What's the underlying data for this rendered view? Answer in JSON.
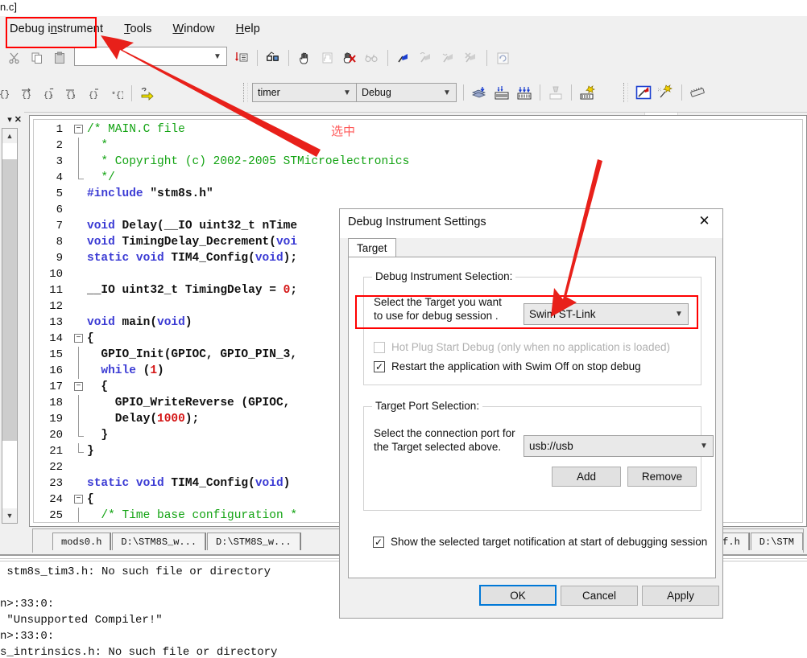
{
  "window": {
    "title_fragment": "n.c]"
  },
  "menubar": {
    "items": [
      {
        "name": "debug-instrument",
        "pre": "Debug i",
        "u": "n",
        "post": "strument"
      },
      {
        "name": "tools",
        "pre": "",
        "u": "T",
        "post": "ools"
      },
      {
        "name": "window",
        "pre": "",
        "u": "W",
        "post": "indow"
      },
      {
        "name": "help",
        "pre": "",
        "u": "H",
        "post": "elp"
      }
    ]
  },
  "toolbar_top": {
    "cut_icon": "scissors-icon",
    "copy_icon": "copy-icon",
    "paste_icon": "paste-icon",
    "find_combo_value": "",
    "find_combo_placeholder": "",
    "goto_icon": "goto-line-icon",
    "binoculars_icon": "find-in-files-icon",
    "hand_icon": "hand-icon",
    "page_icon": "page-icon",
    "no_glasses_icon": "disable-watch-icon",
    "glasses_icon": "watch-icon",
    "flag_blue_icon": "bookmark-flag-icon",
    "flag_next_icon": "next-bookmark-icon",
    "flag_prev_icon": "prev-bookmark-icon",
    "flag_clear_icon": "clear-bookmark-icon",
    "refresh_icon": "refresh-icon",
    "printer_gear_icon": "printer-settings-icon"
  },
  "toolbar_second": {
    "brace_icons": [
      "brace-icon",
      "brace-right-icon",
      "brace-up-icon",
      "brace-down-icon",
      "brace-match-icon",
      "brace-star-icon"
    ],
    "yellow_arrow_icon": "run-to-cursor-icon",
    "project_combo_value": "timer",
    "config_combo_value": "Debug",
    "build_icon": "build-icon",
    "rebuild_icon": "rebuild-all-icon",
    "batch_build_icon": "batch-build-icon",
    "clean_icon": "clean-icon",
    "settings_icon": "project-settings-icon",
    "debug_icon": "start-debug-icon",
    "debug_settings_icon": "debug-settings-icon",
    "chip_icon": "chip-icon"
  },
  "left_dock": {
    "dropdown_icon": "chevron-down-icon",
    "close_icon": "close-icon",
    "scroll_up_icon": "scroll-up-icon",
    "scroll_down_icon": "scroll-down-icon"
  },
  "editor": {
    "annotation_cn": "选中",
    "lines": [
      {
        "n": "1",
        "fold": "minus-top",
        "segs": [
          {
            "t": "/* MAIN.C file",
            "c": "c-com"
          }
        ]
      },
      {
        "n": "2",
        "fold": "line",
        "segs": [
          {
            "t": "  *",
            "c": "c-com"
          }
        ]
      },
      {
        "n": "3",
        "fold": "line",
        "segs": [
          {
            "t": "  * Copyright (c) 2002-2005 STMicroelectronics",
            "c": "c-com"
          }
        ]
      },
      {
        "n": "4",
        "fold": "end",
        "segs": [
          {
            "t": "  */",
            "c": "c-com"
          }
        ]
      },
      {
        "n": "5",
        "fold": "",
        "segs": [
          {
            "t": "#include ",
            "c": "c-pre"
          },
          {
            "t": "\"stm8s.h\"",
            "c": "c-str"
          }
        ]
      },
      {
        "n": "6",
        "fold": "",
        "segs": [
          {
            "t": "",
            "c": "c-pl"
          }
        ]
      },
      {
        "n": "7",
        "fold": "",
        "segs": [
          {
            "t": "void ",
            "c": "c-kw c-bold"
          },
          {
            "t": "Delay(__IO uint32_t nTime",
            "c": "c-pl c-bold"
          }
        ]
      },
      {
        "n": "8",
        "fold": "",
        "segs": [
          {
            "t": "void ",
            "c": "c-kw c-bold"
          },
          {
            "t": "TimingDelay_Decrement(",
            "c": "c-pl c-bold"
          },
          {
            "t": "voi",
            "c": "c-kw c-bold"
          }
        ]
      },
      {
        "n": "9",
        "fold": "",
        "segs": [
          {
            "t": "static void ",
            "c": "c-kw c-bold"
          },
          {
            "t": "TIM4_Config(",
            "c": "c-pl c-bold"
          },
          {
            "t": "void",
            "c": "c-kw c-bold"
          },
          {
            "t": ");",
            "c": "c-pl c-bold"
          }
        ]
      },
      {
        "n": "10",
        "fold": "",
        "segs": [
          {
            "t": "",
            "c": "c-pl"
          }
        ]
      },
      {
        "n": "11",
        "fold": "",
        "segs": [
          {
            "t": "__IO uint32_t TimingDelay = ",
            "c": "c-pl c-bold"
          },
          {
            "t": "0",
            "c": "c-num c-bold"
          },
          {
            "t": ";",
            "c": "c-pl c-bold"
          }
        ]
      },
      {
        "n": "12",
        "fold": "",
        "segs": [
          {
            "t": "",
            "c": "c-pl"
          }
        ]
      },
      {
        "n": "13",
        "fold": "",
        "segs": [
          {
            "t": "void ",
            "c": "c-kw c-bold"
          },
          {
            "t": "main(",
            "c": "c-pl c-bold"
          },
          {
            "t": "void",
            "c": "c-kw c-bold"
          },
          {
            "t": ")",
            "c": "c-pl c-bold"
          }
        ]
      },
      {
        "n": "14",
        "fold": "minus-top",
        "segs": [
          {
            "t": "{",
            "c": "c-pl c-bold"
          }
        ]
      },
      {
        "n": "15",
        "fold": "line",
        "segs": [
          {
            "t": "  GPIO_Init(GPIOC, GPIO_PIN_3,",
            "c": "c-pl c-bold"
          }
        ]
      },
      {
        "n": "16",
        "fold": "line",
        "segs": [
          {
            "t": "  ",
            "c": "c-pl"
          },
          {
            "t": "while ",
            "c": "c-kw c-bold"
          },
          {
            "t": "(",
            "c": "c-pl c-bold"
          },
          {
            "t": "1",
            "c": "c-num c-bold"
          },
          {
            "t": ")",
            "c": "c-pl c-bold"
          }
        ]
      },
      {
        "n": "17",
        "fold": "minus-mid",
        "segs": [
          {
            "t": "  {",
            "c": "c-pl c-bold"
          }
        ]
      },
      {
        "n": "18",
        "fold": "line2",
        "segs": [
          {
            "t": "    GPIO_WriteReverse (GPIOC,",
            "c": "c-pl c-bold"
          }
        ]
      },
      {
        "n": "19",
        "fold": "line2",
        "segs": [
          {
            "t": "    Delay(",
            "c": "c-pl c-bold"
          },
          {
            "t": "1000",
            "c": "c-num c-bold"
          },
          {
            "t": ");",
            "c": "c-pl c-bold"
          }
        ]
      },
      {
        "n": "20",
        "fold": "endmid",
        "segs": [
          {
            "t": "  }",
            "c": "c-pl c-bold"
          }
        ]
      },
      {
        "n": "21",
        "fold": "end",
        "segs": [
          {
            "t": "}",
            "c": "c-pl c-bold"
          }
        ]
      },
      {
        "n": "22",
        "fold": "",
        "segs": [
          {
            "t": "",
            "c": "c-pl"
          }
        ]
      },
      {
        "n": "23",
        "fold": "",
        "segs": [
          {
            "t": "static void ",
            "c": "c-kw c-bold"
          },
          {
            "t": "TIM4_Config(",
            "c": "c-pl c-bold"
          },
          {
            "t": "void",
            "c": "c-kw c-bold"
          },
          {
            "t": ")",
            "c": "c-pl c-bold"
          }
        ]
      },
      {
        "n": "24",
        "fold": "minus-top",
        "segs": [
          {
            "t": "{",
            "c": "c-pl c-bold"
          }
        ]
      },
      {
        "n": "25",
        "fold": "line",
        "segs": [
          {
            "t": "  /* Time base configuration *",
            "c": "c-com"
          }
        ]
      }
    ]
  },
  "file_tabs": {
    "left": [
      {
        "label": "mods0.h"
      },
      {
        "label": "D:\\STM8S_w..."
      },
      {
        "label": "D:\\STM8S_w..."
      }
    ],
    "right": [
      {
        "label": "_conf.h"
      },
      {
        "label": "D:\\STM"
      }
    ]
  },
  "output": {
    "lines": [
      " stm8s_tim3.h: No such file or directory",
      "",
      "n>:33:0:",
      " \"Unsupported Compiler!\"",
      "n>:33:0:",
      "s_intrinsics.h: No such file or directory"
    ]
  },
  "dialog": {
    "title": "Debug Instrument Settings",
    "close_icon": "close-icon",
    "tab_label": "Target",
    "group_instrument": {
      "legend": "Debug Instrument Selection:",
      "target_label_line1": "Select the Target you want",
      "target_label_line2": "to use for debug session .",
      "target_combo_value": "Swim ST-Link",
      "hotplug_checkbox": {
        "label": "Hot Plug Start Debug (only when no application is loaded)",
        "checked": false,
        "enabled": false,
        "mark": ""
      },
      "restart_checkbox": {
        "label": "Restart the application with Swim Off on stop debug",
        "checked": true,
        "mark": "✓"
      }
    },
    "group_port": {
      "legend": "Target Port Selection:",
      "port_label_line1": "Select the connection port for",
      "port_label_line2": "the Target selected above.",
      "port_combo_value": "usb://usb",
      "add_button": "Add",
      "remove_button": "Remove"
    },
    "show_notification_checkbox": {
      "label": "Show the selected target notification at start of debugging session",
      "checked": true,
      "mark": "✓"
    },
    "buttons": {
      "ok": "OK",
      "cancel": "Cancel",
      "apply": "Apply"
    }
  },
  "annotations": {
    "highlight_color": "#ff0000",
    "arrow_color": "#e8201a",
    "cn_text_color": "#ff5a5a"
  }
}
